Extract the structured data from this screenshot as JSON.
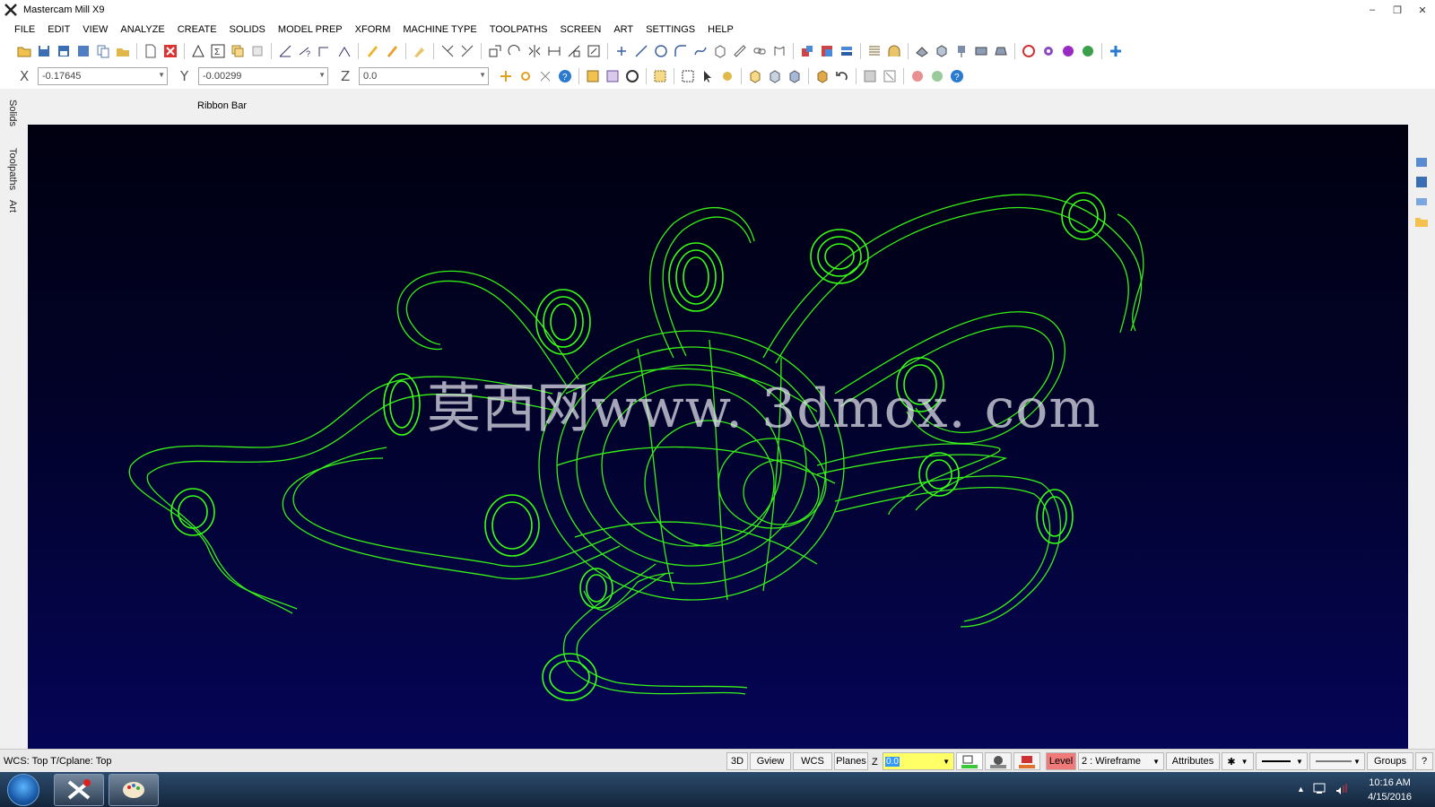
{
  "window": {
    "title": "Mastercam Mill X9"
  },
  "menu": [
    "FILE",
    "EDIT",
    "VIEW",
    "ANALYZE",
    "CREATE",
    "SOLIDS",
    "MODEL PREP",
    "XFORM",
    "MACHINE TYPE",
    "TOOLPATHS",
    "SCREEN",
    "ART",
    "SETTINGS",
    "HELP"
  ],
  "coords": {
    "x_label": "X",
    "x_value": "-0.17645",
    "y_label": "Y",
    "y_value": "-0.00299",
    "z_label": "Z",
    "z_value": "0.0"
  },
  "ribbon": {
    "label": "Ribbon Bar"
  },
  "left_tabs": [
    "Solids",
    "Toolpaths",
    "Art"
  ],
  "viewport": {
    "watermark": "莫西网www. 3dmox. com",
    "wire_color": "#39ff14"
  },
  "status": {
    "left_text": "WCS: Top  T/Cplane: Top",
    "btn_3d": "3D",
    "btn_gview": "Gview",
    "btn_wcs": "WCS",
    "btn_planes": "Planes",
    "z_label": "Z",
    "z_value": "0.0",
    "level_label": "Level",
    "level_value": "2 : Wireframe",
    "attributes": "Attributes",
    "groups": "Groups",
    "help": "?"
  },
  "taskbar": {
    "time": "10:16 AM",
    "date": "4/15/2016"
  }
}
